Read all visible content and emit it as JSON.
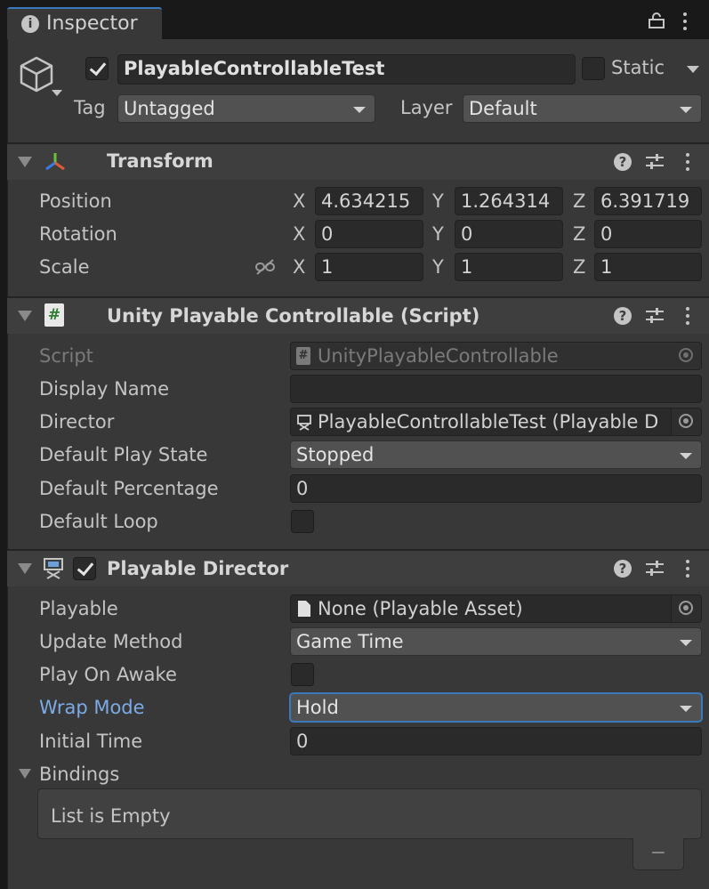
{
  "window": {
    "tab_title": "Inspector"
  },
  "object": {
    "name": "PlayableControllableTest",
    "active": true,
    "static_label": "Static",
    "static_checked": false,
    "tag_label": "Tag",
    "tag_value": "Untagged",
    "layer_label": "Layer",
    "layer_value": "Default"
  },
  "transform": {
    "title": "Transform",
    "position": {
      "label": "Position",
      "x": "4.634215",
      "y": "1.264314",
      "z": "6.391719"
    },
    "rotation": {
      "label": "Rotation",
      "x": "0",
      "y": "0",
      "z": "0"
    },
    "scale": {
      "label": "Scale",
      "x": "1",
      "y": "1",
      "z": "1"
    },
    "axis_x": "X",
    "axis_y": "Y",
    "axis_z": "Z"
  },
  "script_component": {
    "title": "Unity Playable Controllable (Script)",
    "script_label": "Script",
    "script_value": "UnityPlayableControllable",
    "display_name_label": "Display Name",
    "display_name_value": "",
    "director_label": "Director",
    "director_value": "PlayableControllableTest (Playable D",
    "default_play_state_label": "Default Play State",
    "default_play_state_value": "Stopped",
    "default_percentage_label": "Default Percentage",
    "default_percentage_value": "0",
    "default_loop_label": "Default Loop",
    "default_loop_checked": false
  },
  "playable_director": {
    "title": "Playable Director",
    "enabled": true,
    "playable_label": "Playable",
    "playable_value": "None (Playable Asset)",
    "update_method_label": "Update Method",
    "update_method_value": "Game Time",
    "play_on_awake_label": "Play On Awake",
    "play_on_awake_checked": false,
    "wrap_mode_label": "Wrap Mode",
    "wrap_mode_value": "Hold",
    "initial_time_label": "Initial Time",
    "initial_time_value": "0",
    "bindings_label": "Bindings",
    "bindings_empty_text": "List is Empty",
    "remove_button_label": "−"
  },
  "colors": {
    "accent": "#3a79bb",
    "highlight_label": "#7babe6",
    "panel_bg": "#383838"
  }
}
